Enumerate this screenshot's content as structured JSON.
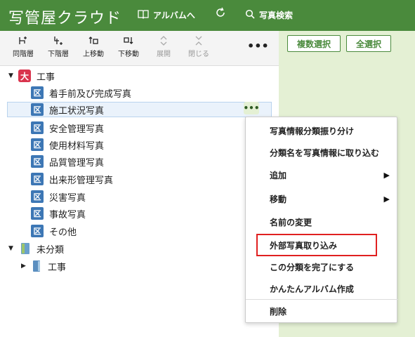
{
  "header": {
    "logo": "写管屋クラウド",
    "album_nav": "アルバムへ",
    "search": "写真検索"
  },
  "actions": {
    "multi_select": "複数選択",
    "select_all": "全選択"
  },
  "toolbar": {
    "items": [
      {
        "label": "同階層",
        "icon": "add-sibling-icon",
        "disabled": false
      },
      {
        "label": "下階層",
        "icon": "add-child-icon",
        "disabled": false
      },
      {
        "label": "上移動",
        "icon": "move-up-icon",
        "disabled": false
      },
      {
        "label": "下移動",
        "icon": "move-down-icon",
        "disabled": false
      },
      {
        "label": "展開",
        "icon": "expand-icon",
        "disabled": true
      },
      {
        "label": "閉じる",
        "icon": "collapse-icon",
        "disabled": true
      }
    ],
    "more": "•••"
  },
  "tree": {
    "root": {
      "badge": "大",
      "label": "工事"
    },
    "children": [
      {
        "badge": "区",
        "label": "着手前及び完成写真"
      },
      {
        "badge": "区",
        "label": "施工状況写真",
        "selected": true
      },
      {
        "badge": "区",
        "label": "安全管理写真"
      },
      {
        "badge": "区",
        "label": "使用材料写真"
      },
      {
        "badge": "区",
        "label": "品質管理写真"
      },
      {
        "badge": "区",
        "label": "出来形管理写真"
      },
      {
        "badge": "区",
        "label": "災害写真"
      },
      {
        "badge": "区",
        "label": "事故写真"
      },
      {
        "badge": "区",
        "label": "その他"
      }
    ],
    "unclassified": {
      "label": "未分類"
    },
    "unclassified_child": {
      "label": "工事"
    },
    "row_more": "•••"
  },
  "menu": {
    "items": [
      {
        "label": "写真情報分類振り分け"
      },
      {
        "label": "分類名を写真情報に取り込む"
      },
      {
        "label": "追加",
        "submenu": true
      },
      {
        "label": "移動",
        "submenu": true
      },
      {
        "label": "名前の変更"
      },
      {
        "label": "外部写真取り込み",
        "highlighted": true
      },
      {
        "label": "この分類を完了にする"
      },
      {
        "label": "かんたんアルバム作成"
      },
      {
        "label": "削除"
      }
    ],
    "submenu_arrow": "▶"
  },
  "colors": {
    "header_green": "#4a8a3c",
    "pane_green": "#e4f0d4",
    "badge_red": "#d9344d",
    "badge_blue": "#3d77b5",
    "highlight_red": "#e02020"
  }
}
